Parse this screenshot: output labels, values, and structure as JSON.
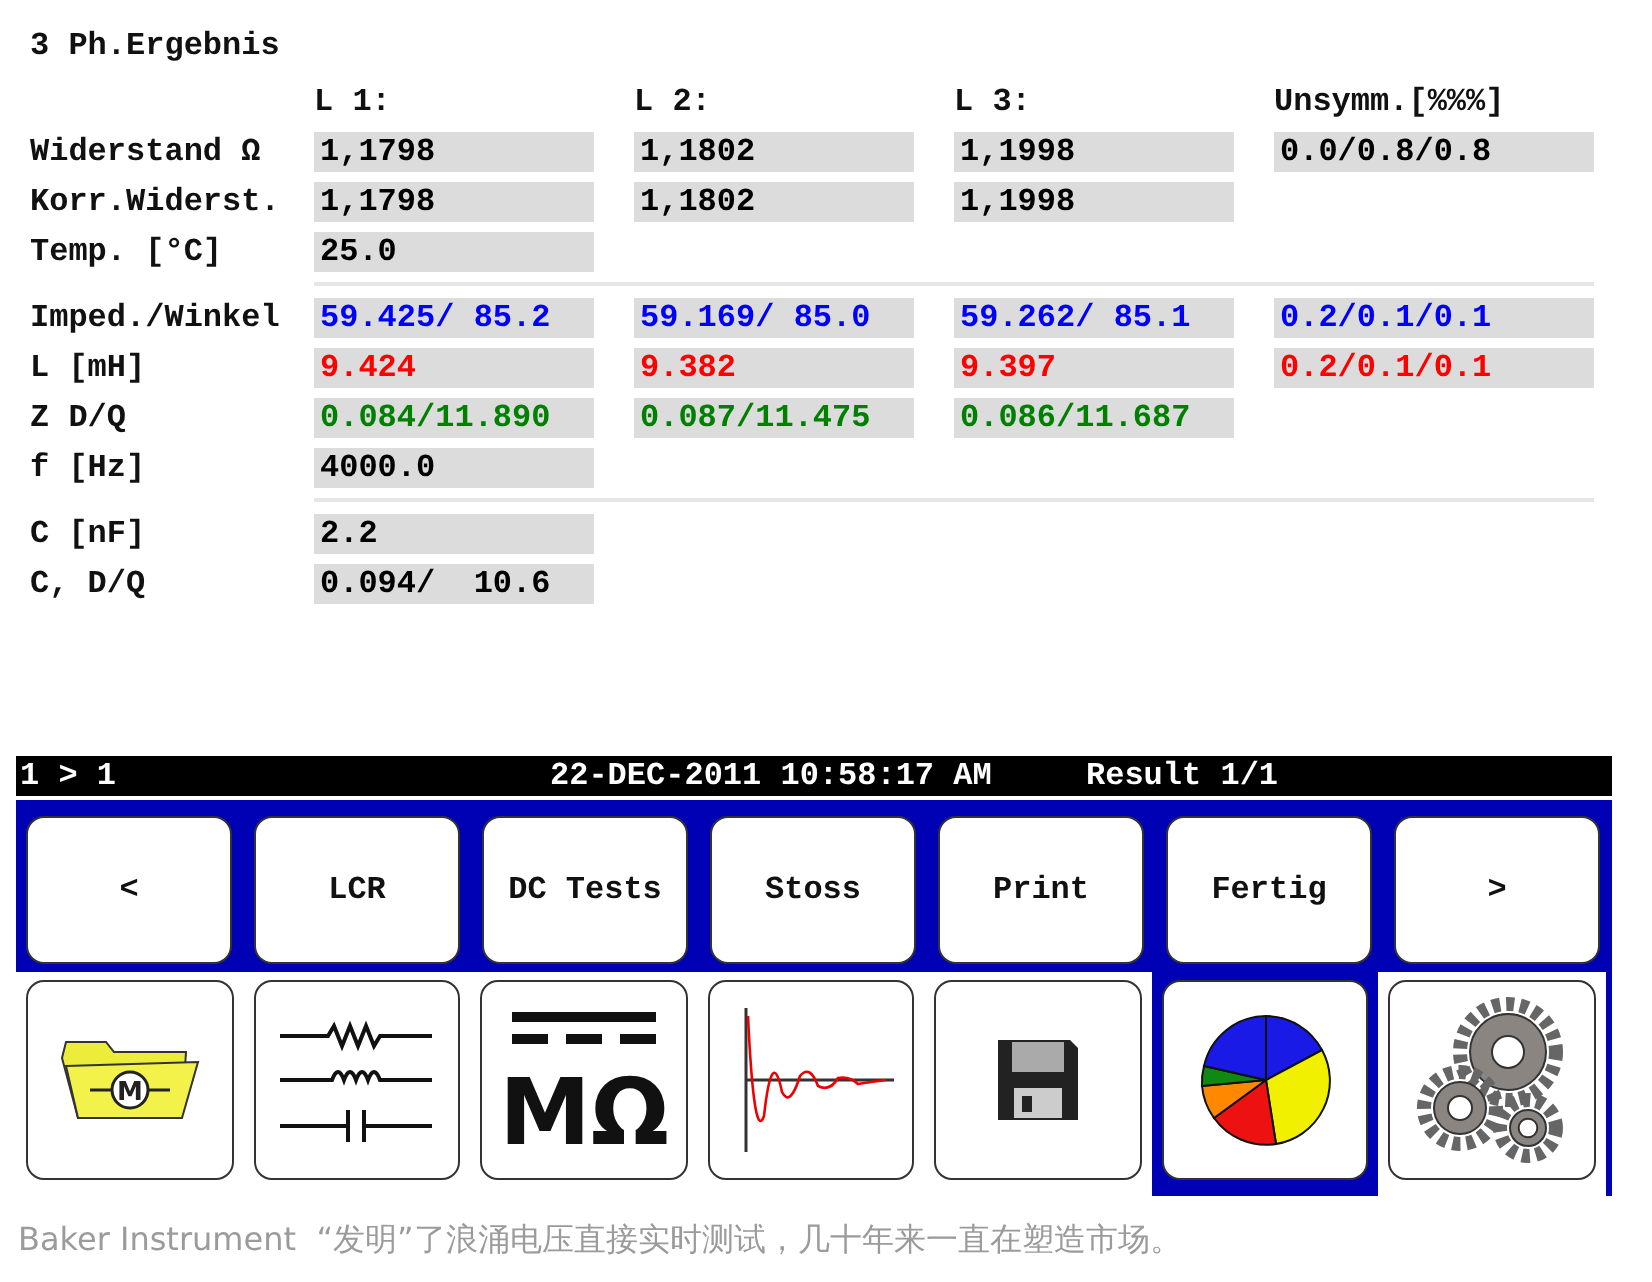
{
  "title": "3 Ph.Ergebnis",
  "columns": [
    "L 1:",
    "L 2:",
    "L 3:",
    "Unsymm.[%%%]"
  ],
  "sections": [
    {
      "rows": [
        {
          "label": "Widerstand Ω",
          "color": "#000000",
          "cells": [
            "1,1798",
            "1,1802",
            "1,1998",
            "0.0/0.8/0.8"
          ]
        },
        {
          "label": "Korr.Widerst.",
          "color": "#000000",
          "cells": [
            "1,1798",
            "1,1802",
            "1,1998",
            null
          ]
        },
        {
          "label": "Temp. [°C]",
          "color": "#000000",
          "cells": [
            "25.0",
            null,
            null,
            null
          ]
        }
      ]
    },
    {
      "rows": [
        {
          "label": "Imped./Winkel",
          "color": "#0000ff",
          "cells": [
            "59.425/ 85.2",
            "59.169/ 85.0",
            "59.262/ 85.1",
            "0.2/0.1/0.1"
          ]
        },
        {
          "label": "L [mH]",
          "color": "#ff0000",
          "cells": [
            "9.424",
            "9.382",
            "9.397",
            "0.2/0.1/0.1"
          ]
        },
        {
          "label": "Z D/Q",
          "color": "#008000",
          "cells": [
            "0.084/11.890",
            "0.087/11.475",
            "0.086/11.687",
            null
          ]
        },
        {
          "label": "f [Hz]",
          "color": "#000000",
          "cells": [
            "4000.0",
            null,
            null,
            null
          ]
        }
      ]
    },
    {
      "rows": [
        {
          "label": "C [nF]",
          "color": "#000000",
          "cells": [
            "2.2",
            null,
            null,
            null
          ]
        },
        {
          "label": "C, D/Q",
          "color": "#000000",
          "cells": [
            "0.094/  10.6",
            null,
            null,
            null
          ]
        }
      ]
    }
  ],
  "status_bar": {
    "left": "1 > 1",
    "datetime": "22-DEC-2011 10:58:17 AM",
    "result": "Result 1/1"
  },
  "buttons": [
    "<",
    "LCR",
    "DC Tests",
    "Stoss",
    "Print",
    "Fertig",
    ">"
  ],
  "tiles": [
    {
      "kind": "motor-folder",
      "label": "M",
      "selected": false
    },
    {
      "kind": "circuit",
      "selected": false
    },
    {
      "kind": "megohm",
      "label": "MΩ",
      "selected": false
    },
    {
      "kind": "wave",
      "selected": false
    },
    {
      "kind": "floppy",
      "selected": false
    },
    {
      "kind": "pie",
      "selected": true
    },
    {
      "kind": "gears",
      "selected": false
    }
  ],
  "caption": "Baker Instrument  “发明”了浪涌电压直接实时测试，几十年来一直在塑造市场。"
}
